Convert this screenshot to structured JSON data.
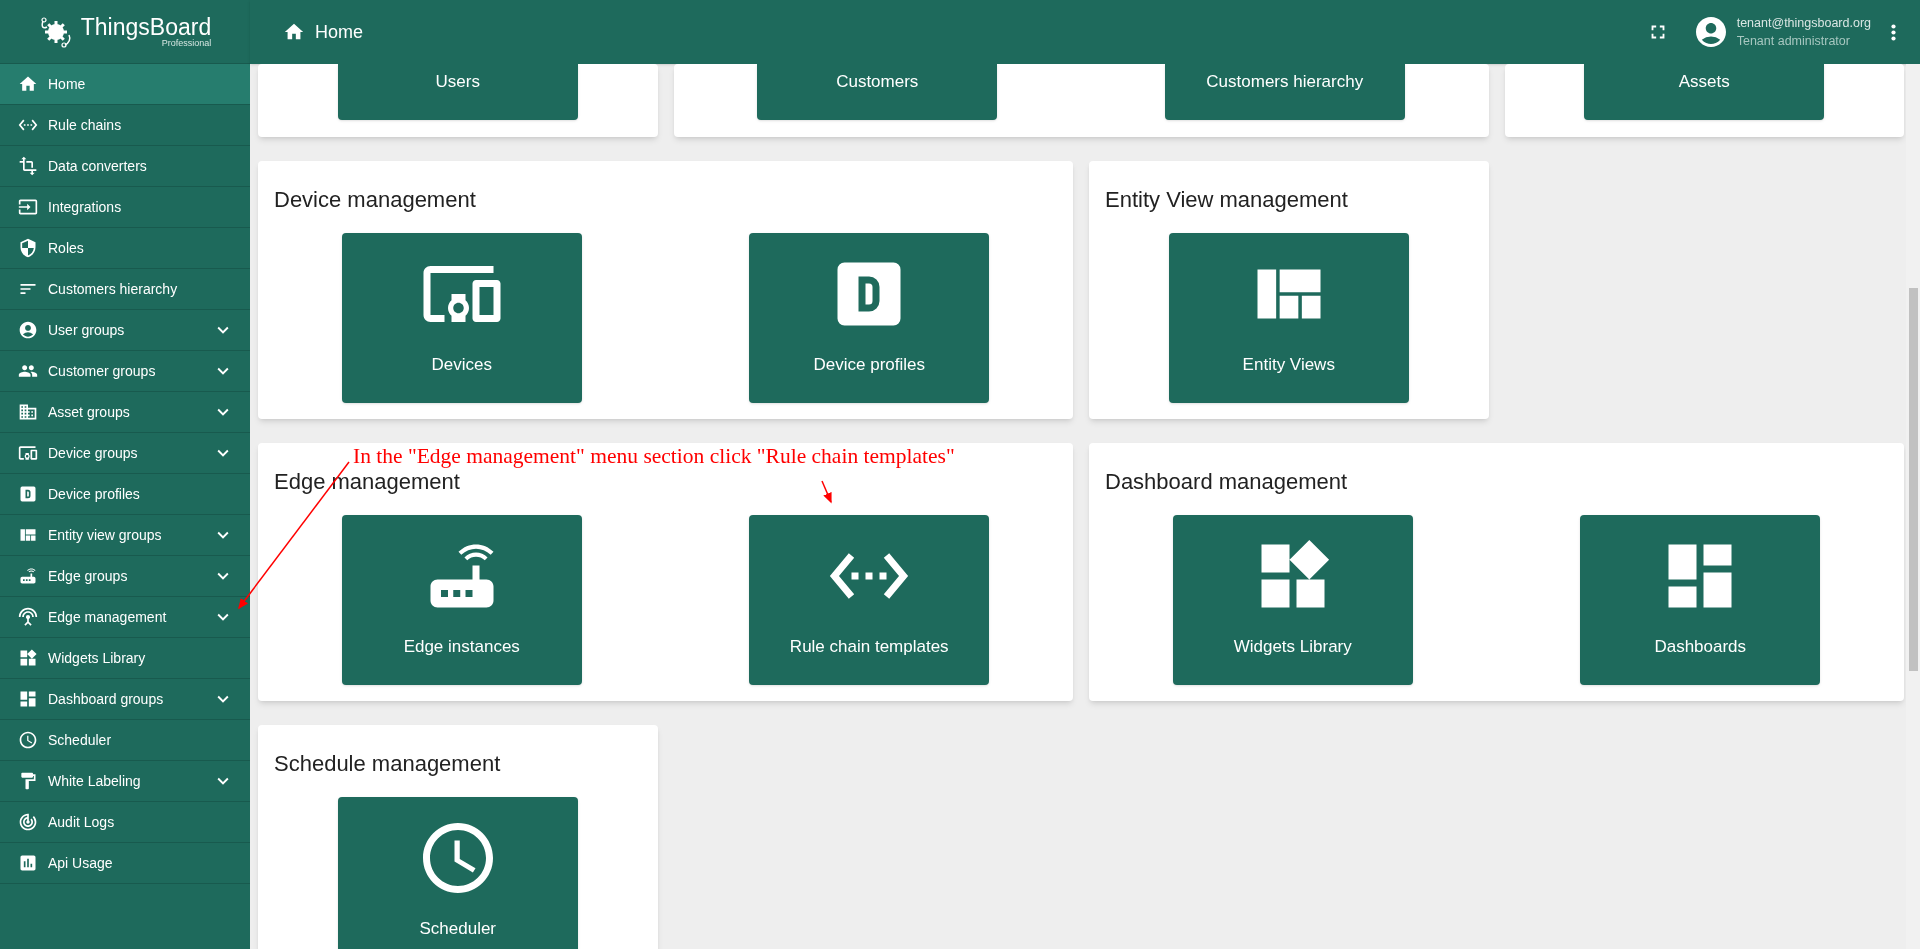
{
  "logo": {
    "name": "ThingsBoard",
    "edition": "Professional"
  },
  "header": {
    "title": "Home",
    "user": {
      "email": "tenant@thingsboard.org",
      "role": "Tenant administrator"
    }
  },
  "sidebar": {
    "items": [
      {
        "label": "Home",
        "selected": true,
        "has_submenu": false
      },
      {
        "label": "Rule chains",
        "selected": false,
        "has_submenu": false
      },
      {
        "label": "Data converters",
        "selected": false,
        "has_submenu": false
      },
      {
        "label": "Integrations",
        "selected": false,
        "has_submenu": false
      },
      {
        "label": "Roles",
        "selected": false,
        "has_submenu": false
      },
      {
        "label": "Customers hierarchy",
        "selected": false,
        "has_submenu": false
      },
      {
        "label": "User groups",
        "selected": false,
        "has_submenu": true
      },
      {
        "label": "Customer groups",
        "selected": false,
        "has_submenu": true
      },
      {
        "label": "Asset groups",
        "selected": false,
        "has_submenu": true
      },
      {
        "label": "Device groups",
        "selected": false,
        "has_submenu": true
      },
      {
        "label": "Device profiles",
        "selected": false,
        "has_submenu": false
      },
      {
        "label": "Entity view groups",
        "selected": false,
        "has_submenu": true
      },
      {
        "label": "Edge groups",
        "selected": false,
        "has_submenu": true
      },
      {
        "label": "Edge management",
        "selected": false,
        "has_submenu": true
      },
      {
        "label": "Widgets Library",
        "selected": false,
        "has_submenu": false
      },
      {
        "label": "Dashboard groups",
        "selected": false,
        "has_submenu": true
      },
      {
        "label": "Scheduler",
        "selected": false,
        "has_submenu": false
      },
      {
        "label": "White Labeling",
        "selected": false,
        "has_submenu": true
      },
      {
        "label": "Audit Logs",
        "selected": false,
        "has_submenu": false
      },
      {
        "label": "Api Usage",
        "selected": false,
        "has_submenu": false
      }
    ]
  },
  "sections": [
    {
      "kind": "cut",
      "tiles": [
        {
          "label": "Users"
        }
      ]
    },
    {
      "kind": "cut",
      "tiles": [
        {
          "label": "Customers"
        },
        {
          "label": "Customers hierarchy"
        }
      ]
    },
    {
      "kind": "cut",
      "tiles": [
        {
          "label": "Assets"
        }
      ]
    },
    {
      "kind": "full",
      "title": "Device management",
      "tiles": [
        {
          "label": "Devices"
        },
        {
          "label": "Device profiles"
        }
      ]
    },
    {
      "kind": "full",
      "title": "Entity View management",
      "tiles": [
        {
          "label": "Entity Views"
        }
      ]
    },
    {
      "kind": "full",
      "title": "Edge management",
      "tiles": [
        {
          "label": "Edge instances"
        },
        {
          "label": "Rule chain templates"
        }
      ]
    },
    {
      "kind": "full",
      "title": "Dashboard management",
      "tiles": [
        {
          "label": "Widgets Library"
        },
        {
          "label": "Dashboards"
        }
      ]
    },
    {
      "kind": "full",
      "title": "Schedule management",
      "tiles": [
        {
          "label": "Scheduler"
        }
      ]
    }
  ],
  "annotation": {
    "text": "In the \"Edge management\" menu section click \"Rule chain templates\""
  }
}
